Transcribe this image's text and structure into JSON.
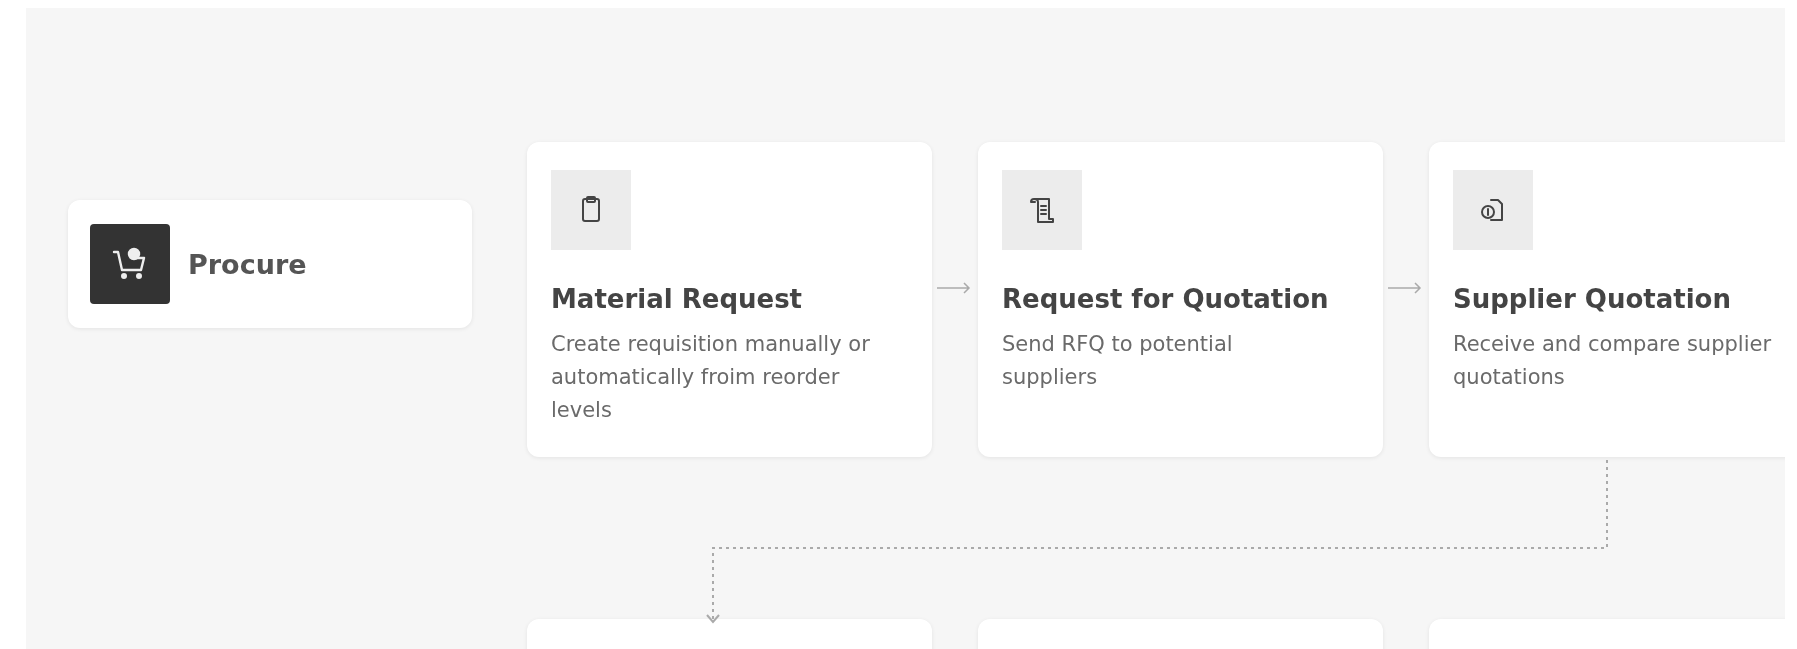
{
  "start": {
    "title": "Procure"
  },
  "steps": [
    {
      "title": "Material Request",
      "description": "Create requisition manually or automatically froim reorder levels"
    },
    {
      "title": "Request for Quotation",
      "description": "Send RFQ to potential suppliers"
    },
    {
      "title": "Supplier Quotation",
      "description": "Receive and compare supplier quotations"
    }
  ]
}
